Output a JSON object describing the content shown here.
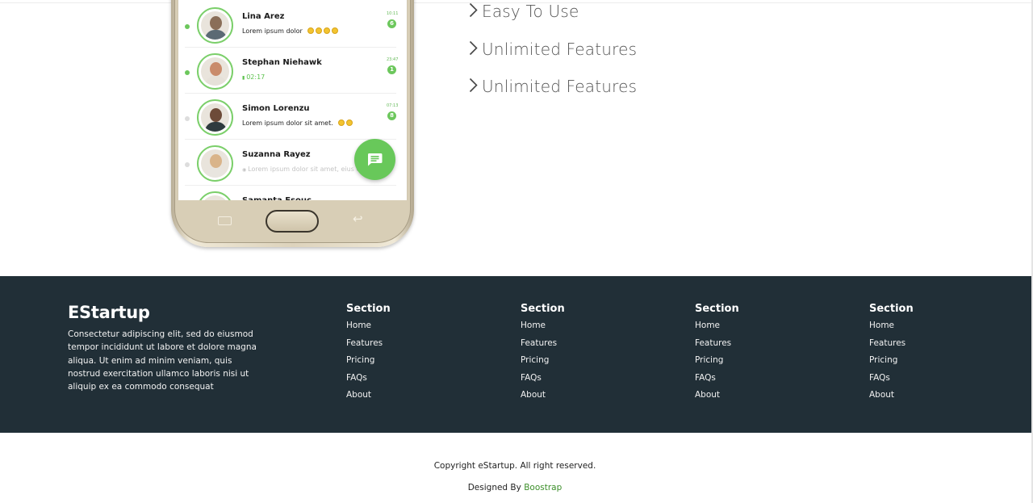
{
  "phone": {
    "chats": [
      {
        "name": "Lina Arez",
        "message": "Lorem ipsum dolor",
        "time": "10:11",
        "badge": "6",
        "dot_color": "#6cc75c",
        "emoji_count": 4,
        "style": "normal"
      },
      {
        "name": "Stephan Niehawk",
        "message": "02:17",
        "time": "23:47",
        "badge": "1",
        "dot_color": "#6cc75c",
        "emoji_count": 0,
        "style": "green"
      },
      {
        "name": "Simon Lorenzu",
        "message": "Lorem ipsum dolor sit amet.",
        "time": "07:13",
        "badge": "8",
        "dot_color": "#dddddd",
        "emoji_count": 2,
        "style": "normal"
      },
      {
        "name": "Suzanna Rayez",
        "message": "Lorem ipsum dolor sit amet, eius el",
        "time": "",
        "badge": "",
        "dot_color": "#dddddd",
        "emoji_count": 0,
        "style": "faded"
      },
      {
        "name": "Samanta Esouc",
        "message": "",
        "time": "",
        "badge": "",
        "dot_color": "#dddddd",
        "emoji_count": 0,
        "style": "normal"
      }
    ],
    "fab_icon": "message-icon"
  },
  "features": {
    "items": [
      "Easy To Use",
      "Unlimited Features",
      "Unlimited Features"
    ],
    "chevron_icon": "chevron-right-icon"
  },
  "footer": {
    "brand": "EStartup",
    "description": "Consectetur adipiscing elit, sed do eiusmod tempor incididunt ut labore et dolore magna aliqua. Ut enim ad minim veniam, quis nostrud exercitation ullamco laboris nisi ut aliquip ex ea commodo consequat",
    "columns": [
      {
        "title": "Section",
        "links": [
          "Home",
          "Features",
          "Pricing",
          "FAQs",
          "About"
        ]
      },
      {
        "title": "Section",
        "links": [
          "Home",
          "Features",
          "Pricing",
          "FAQs",
          "About"
        ]
      },
      {
        "title": "Section",
        "links": [
          "Home",
          "Features",
          "Pricing",
          "FAQs",
          "About"
        ]
      },
      {
        "title": "Section",
        "links": [
          "Home",
          "Features",
          "Pricing",
          "FAQs",
          "About"
        ]
      }
    ],
    "background": "#212f37"
  },
  "bottom": {
    "copyright": "Copyright eStartup. All right reserved.",
    "credit_prefix": "Designed By",
    "credit_link": "Boostrap",
    "credit_color": "#3c8f2a"
  },
  "colors": {
    "accent": "#6cc75c"
  }
}
